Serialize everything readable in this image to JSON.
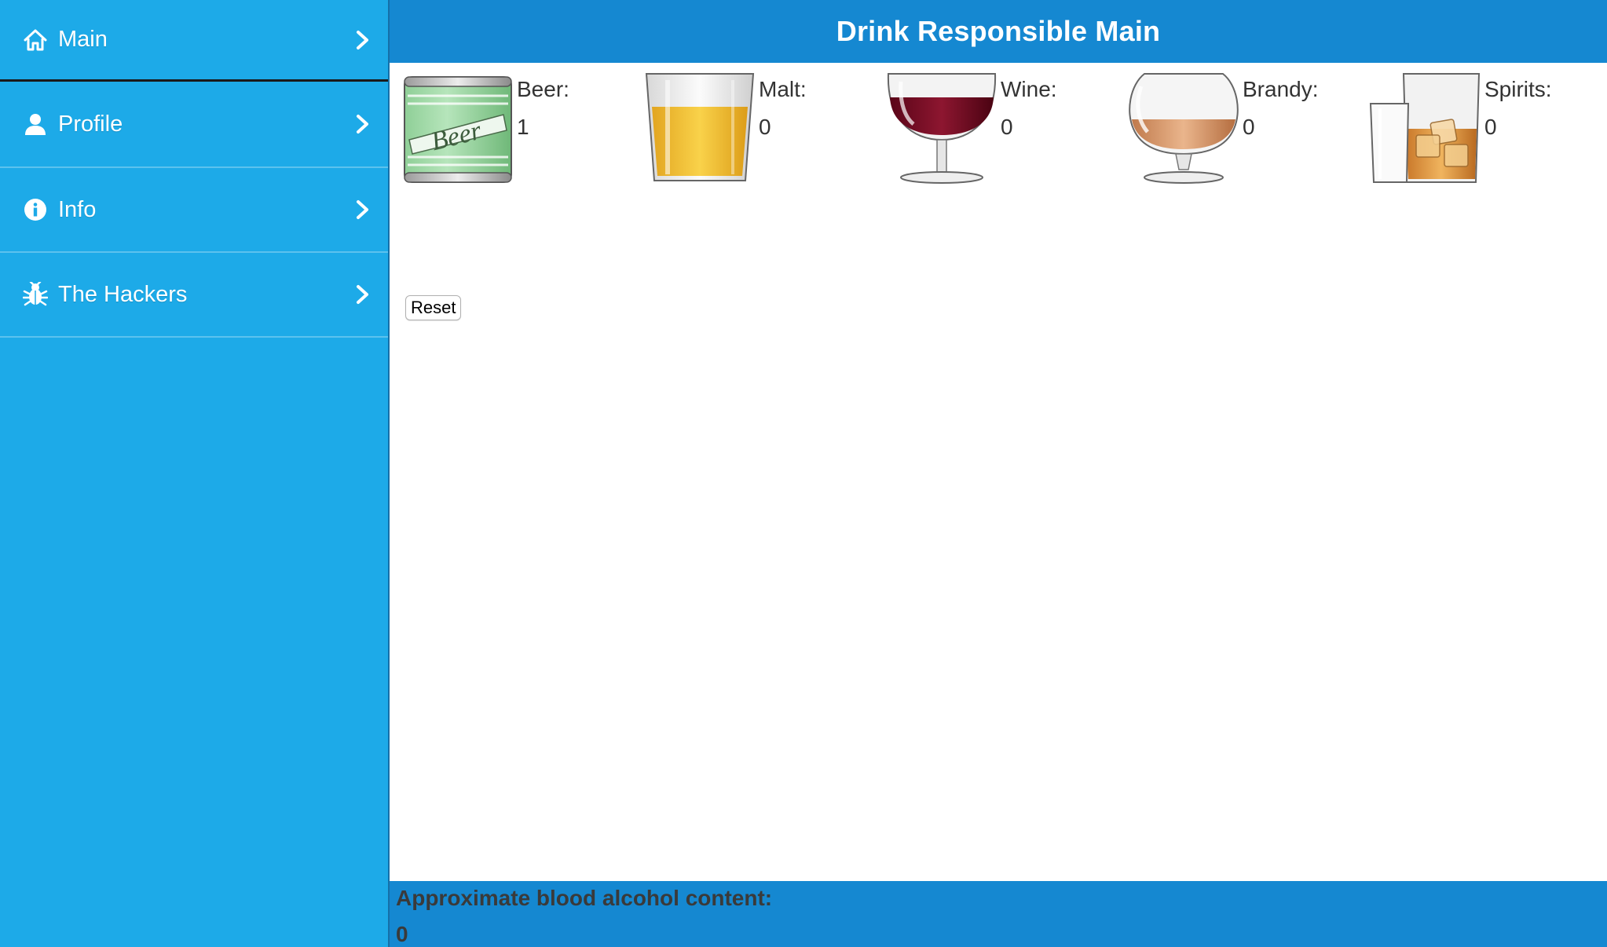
{
  "sidebar": {
    "items": [
      {
        "label": "Main",
        "icon": "home-icon"
      },
      {
        "label": "Profile",
        "icon": "user-icon"
      },
      {
        "label": "Info",
        "icon": "info-icon"
      },
      {
        "label": "The Hackers",
        "icon": "bug-icon"
      }
    ]
  },
  "header": {
    "title": "Drink Responsible Main"
  },
  "drinks": [
    {
      "label": "Beer:",
      "count": "1",
      "icon": "beer-can-icon",
      "image_text": "Beer"
    },
    {
      "label": "Malt:",
      "count": "0",
      "icon": "malt-glass-icon"
    },
    {
      "label": "Wine:",
      "count": "0",
      "icon": "wine-glass-icon"
    },
    {
      "label": "Brandy:",
      "count": "0",
      "icon": "brandy-glass-icon"
    },
    {
      "label": "Spirits:",
      "count": "0",
      "icon": "spirits-glass-icon"
    }
  ],
  "reset_label": "Reset",
  "footer": {
    "bac_label": "Approximate blood alcohol content:",
    "bac_value": "0"
  },
  "colors": {
    "sidebar_bg": "#1daae8",
    "header_bg": "#1588d1",
    "footer_bg": "#1588d1",
    "text_white": "#ffffff"
  }
}
